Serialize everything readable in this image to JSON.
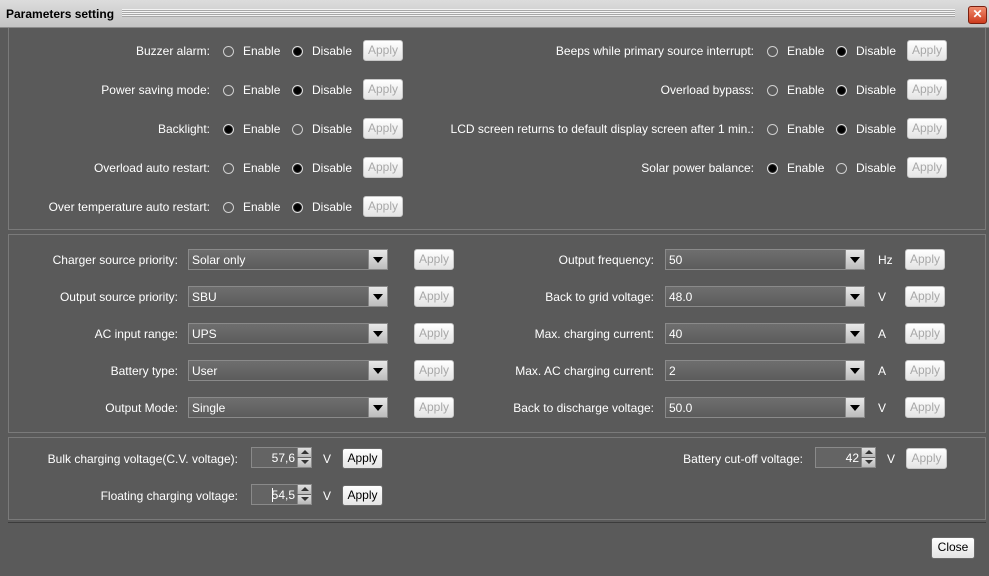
{
  "window": {
    "title": "Parameters setting",
    "close_glyph": "✕"
  },
  "apply_label": "Apply",
  "enable_label": "Enable",
  "disable_label": "Disable",
  "toggles_left": [
    {
      "label": "Buzzer alarm:",
      "selected": "Disable"
    },
    {
      "label": "Power saving mode:",
      "selected": "Disable"
    },
    {
      "label": "Backlight:",
      "selected": "Enable"
    },
    {
      "label": "Overload auto restart:",
      "selected": "Disable"
    },
    {
      "label": "Over temperature auto restart:",
      "selected": "Disable"
    }
  ],
  "toggles_right": [
    {
      "label": "Beeps while primary source interrupt:",
      "selected": "Disable"
    },
    {
      "label": "Overload bypass:",
      "selected": "Disable"
    },
    {
      "label": "LCD screen returns to default display screen after 1 min.:",
      "selected": "Disable"
    },
    {
      "label": "Solar power balance:",
      "selected": "Enable"
    }
  ],
  "selects_left": [
    {
      "label": "Charger source priority:",
      "value": "Solar only"
    },
    {
      "label": "Output source priority:",
      "value": "SBU"
    },
    {
      "label": "AC input range:",
      "value": "UPS"
    },
    {
      "label": "Battery type:",
      "value": "User"
    },
    {
      "label": "Output Mode:",
      "value": "Single"
    }
  ],
  "selects_right": [
    {
      "label": "Output frequency:",
      "value": "50",
      "unit": "Hz"
    },
    {
      "label": "Back to grid voltage:",
      "value": "48.0",
      "unit": "V"
    },
    {
      "label": "Max. charging current:",
      "value": "40",
      "unit": "A"
    },
    {
      "label": "Max. AC charging current:",
      "value": "2",
      "unit": "A"
    },
    {
      "label": "Back to discharge voltage:",
      "value": "50.0",
      "unit": "V"
    }
  ],
  "voltages": {
    "bulk": {
      "label": "Bulk charging voltage(C.V. voltage):",
      "value": "57,6",
      "unit": "V"
    },
    "floating": {
      "label": "Floating charging voltage:",
      "value": "54,5",
      "unit": "V"
    },
    "cutoff": {
      "label": "Battery cut-off voltage:",
      "value": "42",
      "unit": "V"
    }
  },
  "footer": {
    "close_label": "Close"
  }
}
